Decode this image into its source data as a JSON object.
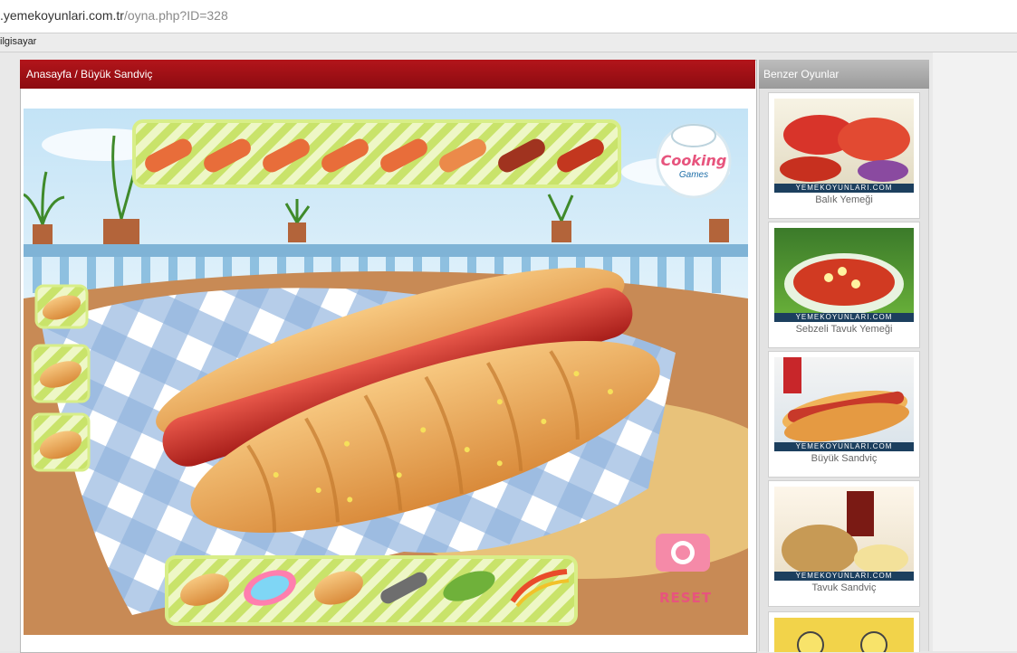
{
  "browser": {
    "url_host": ".yemekoyunlari.com.tr",
    "url_path": "/oyna.php?ID=328",
    "bookmark": "ilgisayar"
  },
  "main": {
    "breadcrumb": "Anasayfa / Büyük Sandviç"
  },
  "game": {
    "reset_label": "RESET",
    "logo_line1": "Cooking",
    "logo_line2": "Games"
  },
  "sidebar": {
    "title": "Benzer Oyunlar",
    "items": [
      {
        "label": "Balık Yemeği"
      },
      {
        "label": "Sebzeli Tavuk Yemeği"
      },
      {
        "label": "Büyük Sandviç"
      },
      {
        "label": "Tavuk Sandviç"
      }
    ],
    "watermark": "YEMEKOYUNLARI.COM"
  },
  "colors": {
    "header_red": "#a01016",
    "sidebar_gray": "#a9a9a9",
    "reset_pink": "#e7547d"
  }
}
